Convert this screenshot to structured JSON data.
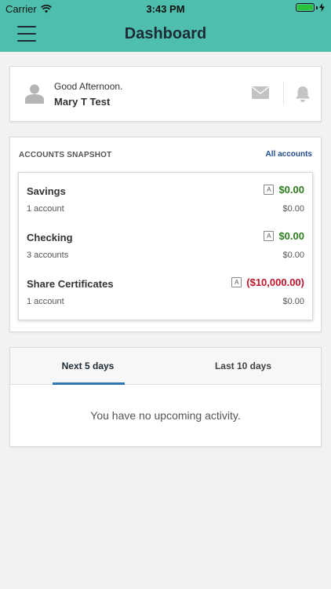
{
  "status_bar": {
    "carrier": "Carrier",
    "time": "3:43 PM"
  },
  "header": {
    "title": "Dashboard",
    "accent_color": "#4fbfad"
  },
  "greeting": {
    "line": "Good Afternoon.",
    "name": "Mary T Test"
  },
  "snapshot": {
    "title": "ACCOUNTS SNAPSHOT",
    "all_accounts_label": "All accounts",
    "accounts": [
      {
        "name": "Savings",
        "count": "1 account",
        "balance": "$0.00",
        "sub_balance": "$0.00",
        "badge": "A",
        "status": "positive"
      },
      {
        "name": "Checking",
        "count": "3 accounts",
        "balance": "$0.00",
        "sub_balance": "$0.00",
        "badge": "A",
        "status": "positive"
      },
      {
        "name": "Share Certificates",
        "count": "1 account",
        "balance": "($10,000.00)",
        "sub_balance": "$0.00",
        "badge": "A",
        "status": "negative"
      }
    ]
  },
  "activity": {
    "tabs": [
      {
        "label": "Next 5 days",
        "active": true
      },
      {
        "label": "Last 10 days",
        "active": false
      }
    ],
    "empty_message": "You have no upcoming activity."
  },
  "colors": {
    "positive": "#2e7d1e",
    "negative": "#c0152b",
    "link": "#1f4d8f",
    "tab_underline": "#2e75b6"
  }
}
